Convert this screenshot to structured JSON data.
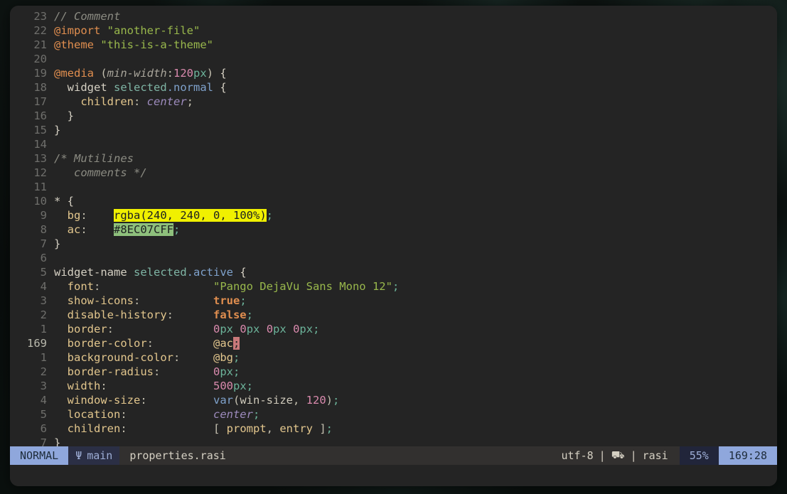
{
  "window": {
    "app": "terminal-text-editor",
    "background_color": "#242424",
    "wallpaper_color": "#0b100e"
  },
  "editor": {
    "filetype": "rasi",
    "cursor_line_number": "169",
    "lines": [
      {
        "num": "23",
        "current": false,
        "tokens": [
          {
            "text": "// Comment",
            "cls": "tok-comment"
          }
        ]
      },
      {
        "num": "22",
        "current": false,
        "tokens": [
          {
            "text": "@import",
            "cls": "tok-at"
          },
          {
            "text": " ",
            "cls": "tok-plain"
          },
          {
            "text": "\"another-file\"",
            "cls": "tok-string"
          }
        ]
      },
      {
        "num": "21",
        "current": false,
        "tokens": [
          {
            "text": "@theme",
            "cls": "tok-at"
          },
          {
            "text": " ",
            "cls": "tok-plain"
          },
          {
            "text": "\"this-is-a-theme\"",
            "cls": "tok-string"
          }
        ]
      },
      {
        "num": "20",
        "current": false,
        "tokens": []
      },
      {
        "num": "19",
        "current": false,
        "tokens": [
          {
            "text": "@media",
            "cls": "tok-at"
          },
          {
            "text": " (",
            "cls": "tok-punct"
          },
          {
            "text": "min-width",
            "cls": "tok-italgrey"
          },
          {
            "text": ":",
            "cls": "tok-punct"
          },
          {
            "text": "120",
            "cls": "tok-num"
          },
          {
            "text": "px",
            "cls": "tok-unit"
          },
          {
            "text": ") ",
            "cls": "tok-punct"
          },
          {
            "text": "{",
            "cls": "tok-plain"
          }
        ]
      },
      {
        "num": "18",
        "current": false,
        "tokens": [
          {
            "text": "  ",
            "cls": "tok-plain"
          },
          {
            "text": "widget",
            "cls": "tok-widget"
          },
          {
            "text": " ",
            "cls": "tok-plain"
          },
          {
            "text": "selected",
            "cls": "tok-class"
          },
          {
            "text": ".normal",
            "cls": "tok-state"
          },
          {
            "text": " ",
            "cls": "tok-plain"
          },
          {
            "text": "{",
            "cls": "tok-plain"
          }
        ]
      },
      {
        "num": "17",
        "current": false,
        "tokens": [
          {
            "text": "    ",
            "cls": "tok-plain"
          },
          {
            "text": "children",
            "cls": "tok-prop"
          },
          {
            "text": ": ",
            "cls": "tok-punct"
          },
          {
            "text": "center",
            "cls": "tok-ital"
          },
          {
            "text": ";",
            "cls": "tok-punct"
          }
        ]
      },
      {
        "num": "16",
        "current": false,
        "tokens": [
          {
            "text": "  }",
            "cls": "tok-plain"
          }
        ]
      },
      {
        "num": "15",
        "current": false,
        "tokens": [
          {
            "text": "}",
            "cls": "tok-plain"
          }
        ]
      },
      {
        "num": "14",
        "current": false,
        "tokens": []
      },
      {
        "num": "13",
        "current": false,
        "tokens": [
          {
            "text": "/* Mutilines",
            "cls": "tok-comment"
          }
        ]
      },
      {
        "num": "12",
        "current": false,
        "tokens": [
          {
            "text": "   comments */",
            "cls": "tok-comment"
          }
        ]
      },
      {
        "num": "11",
        "current": false,
        "tokens": []
      },
      {
        "num": "10",
        "current": false,
        "tokens": [
          {
            "text": "* ",
            "cls": "tok-widget"
          },
          {
            "text": "{",
            "cls": "tok-plain"
          }
        ]
      },
      {
        "num": "9",
        "current": false,
        "tokens": [
          {
            "text": "  ",
            "cls": "tok-plain"
          },
          {
            "text": "bg",
            "cls": "tok-prop"
          },
          {
            "text": ":    ",
            "cls": "tok-punct"
          },
          {
            "text": "rgba(240, 240, 0, 100%)",
            "cls": "swatch-yellow"
          },
          {
            "text": ";",
            "cls": "tok-unit"
          }
        ]
      },
      {
        "num": "8",
        "current": false,
        "tokens": [
          {
            "text": "  ",
            "cls": "tok-plain"
          },
          {
            "text": "ac",
            "cls": "tok-prop"
          },
          {
            "text": ":    ",
            "cls": "tok-punct"
          },
          {
            "text": "#8EC07CFF",
            "cls": "swatch-green"
          },
          {
            "text": ";",
            "cls": "tok-unit"
          }
        ]
      },
      {
        "num": "7",
        "current": false,
        "tokens": [
          {
            "text": "}",
            "cls": "tok-plain"
          }
        ]
      },
      {
        "num": "6",
        "current": false,
        "tokens": []
      },
      {
        "num": "5",
        "current": false,
        "tokens": [
          {
            "text": "widget-name",
            "cls": "tok-widget"
          },
          {
            "text": " ",
            "cls": "tok-plain"
          },
          {
            "text": "selected",
            "cls": "tok-class"
          },
          {
            "text": ".active",
            "cls": "tok-state"
          },
          {
            "text": " ",
            "cls": "tok-plain"
          },
          {
            "text": "{",
            "cls": "tok-plain"
          }
        ]
      },
      {
        "num": "4",
        "current": false,
        "tokens": [
          {
            "text": "  ",
            "cls": "tok-plain"
          },
          {
            "text": "font",
            "cls": "tok-prop"
          },
          {
            "text": ":                 ",
            "cls": "tok-punct"
          },
          {
            "text": "\"Pango DejaVu Sans Mono 12\"",
            "cls": "tok-string"
          },
          {
            "text": ";",
            "cls": "tok-unit"
          }
        ]
      },
      {
        "num": "3",
        "current": false,
        "tokens": [
          {
            "text": "  ",
            "cls": "tok-plain"
          },
          {
            "text": "show-icons",
            "cls": "tok-prop"
          },
          {
            "text": ":           ",
            "cls": "tok-punct"
          },
          {
            "text": "true",
            "cls": "tok-kw"
          },
          {
            "text": ";",
            "cls": "tok-unit"
          }
        ]
      },
      {
        "num": "2",
        "current": false,
        "tokens": [
          {
            "text": "  ",
            "cls": "tok-plain"
          },
          {
            "text": "disable-history",
            "cls": "tok-prop"
          },
          {
            "text": ":      ",
            "cls": "tok-punct"
          },
          {
            "text": "false",
            "cls": "tok-kw"
          },
          {
            "text": ";",
            "cls": "tok-unit"
          }
        ]
      },
      {
        "num": "1",
        "current": false,
        "tokens": [
          {
            "text": "  ",
            "cls": "tok-plain"
          },
          {
            "text": "border",
            "cls": "tok-prop"
          },
          {
            "text": ":               ",
            "cls": "tok-punct"
          },
          {
            "text": "0",
            "cls": "tok-num"
          },
          {
            "text": "px",
            "cls": "tok-unit"
          },
          {
            "text": " ",
            "cls": "tok-plain"
          },
          {
            "text": "0",
            "cls": "tok-num"
          },
          {
            "text": "px",
            "cls": "tok-unit"
          },
          {
            "text": " ",
            "cls": "tok-plain"
          },
          {
            "text": "0",
            "cls": "tok-num"
          },
          {
            "text": "px",
            "cls": "tok-unit"
          },
          {
            "text": " ",
            "cls": "tok-plain"
          },
          {
            "text": "0",
            "cls": "tok-num"
          },
          {
            "text": "px",
            "cls": "tok-unit"
          },
          {
            "text": ";",
            "cls": "tok-unit"
          }
        ]
      },
      {
        "num": "169",
        "current": true,
        "tokens": [
          {
            "text": "  ",
            "cls": "tok-plain"
          },
          {
            "text": "border-color",
            "cls": "tok-prop"
          },
          {
            "text": ":         ",
            "cls": "tok-punct"
          },
          {
            "text": "@ac",
            "cls": "tok-ref"
          },
          {
            "text": ";",
            "cls": "cursor"
          }
        ]
      },
      {
        "num": "1",
        "current": false,
        "tokens": [
          {
            "text": "  ",
            "cls": "tok-plain"
          },
          {
            "text": "background-color",
            "cls": "tok-prop"
          },
          {
            "text": ":     ",
            "cls": "tok-punct"
          },
          {
            "text": "@bg",
            "cls": "tok-ref"
          },
          {
            "text": ";",
            "cls": "tok-unit"
          }
        ]
      },
      {
        "num": "2",
        "current": false,
        "tokens": [
          {
            "text": "  ",
            "cls": "tok-plain"
          },
          {
            "text": "border-radius",
            "cls": "tok-prop"
          },
          {
            "text": ":        ",
            "cls": "tok-punct"
          },
          {
            "text": "0",
            "cls": "tok-num"
          },
          {
            "text": "px",
            "cls": "tok-unit"
          },
          {
            "text": ";",
            "cls": "tok-unit"
          }
        ]
      },
      {
        "num": "3",
        "current": false,
        "tokens": [
          {
            "text": "  ",
            "cls": "tok-plain"
          },
          {
            "text": "width",
            "cls": "tok-prop"
          },
          {
            "text": ":                ",
            "cls": "tok-punct"
          },
          {
            "text": "500",
            "cls": "tok-num"
          },
          {
            "text": "px",
            "cls": "tok-unit"
          },
          {
            "text": ";",
            "cls": "tok-unit"
          }
        ]
      },
      {
        "num": "4",
        "current": false,
        "tokens": [
          {
            "text": "  ",
            "cls": "tok-plain"
          },
          {
            "text": "window-size",
            "cls": "tok-prop"
          },
          {
            "text": ":          ",
            "cls": "tok-punct"
          },
          {
            "text": "var",
            "cls": "tok-func"
          },
          {
            "text": "(",
            "cls": "tok-punct"
          },
          {
            "text": "win-size",
            "cls": "tok-var"
          },
          {
            "text": ", ",
            "cls": "tok-punct"
          },
          {
            "text": "120",
            "cls": "tok-num"
          },
          {
            "text": ")",
            "cls": "tok-punct"
          },
          {
            "text": ";",
            "cls": "tok-unit"
          }
        ]
      },
      {
        "num": "5",
        "current": false,
        "tokens": [
          {
            "text": "  ",
            "cls": "tok-plain"
          },
          {
            "text": "location",
            "cls": "tok-prop"
          },
          {
            "text": ":             ",
            "cls": "tok-punct"
          },
          {
            "text": "center",
            "cls": "tok-ital"
          },
          {
            "text": ";",
            "cls": "tok-unit"
          }
        ]
      },
      {
        "num": "6",
        "current": false,
        "tokens": [
          {
            "text": "  ",
            "cls": "tok-plain"
          },
          {
            "text": "children",
            "cls": "tok-prop"
          },
          {
            "text": ":             ",
            "cls": "tok-punct"
          },
          {
            "text": "[ ",
            "cls": "tok-punct"
          },
          {
            "text": "prompt",
            "cls": "tok-prop"
          },
          {
            "text": ", ",
            "cls": "tok-punct"
          },
          {
            "text": "entry",
            "cls": "tok-prop"
          },
          {
            "text": " ]",
            "cls": "tok-punct"
          },
          {
            "text": ";",
            "cls": "tok-unit"
          }
        ]
      },
      {
        "num": "7",
        "current": false,
        "tokens": [
          {
            "text": "}",
            "cls": "tok-plain"
          }
        ]
      }
    ]
  },
  "statusline": {
    "mode": "NORMAL",
    "branch_icon": "Ψ",
    "branch": "main",
    "filename": "properties.rasi",
    "encoding": "utf-8",
    "separator": "|",
    "lsp_icon": "⛟",
    "filetype": "rasi",
    "percent": "55%",
    "position": "169:28",
    "colors": {
      "mode_bg": "#8fa7dc",
      "branch_bg": "#2b2f45",
      "bar_bg": "#32302f",
      "percent_bg": "#21253a",
      "position_bg": "#8fa7dc"
    }
  }
}
